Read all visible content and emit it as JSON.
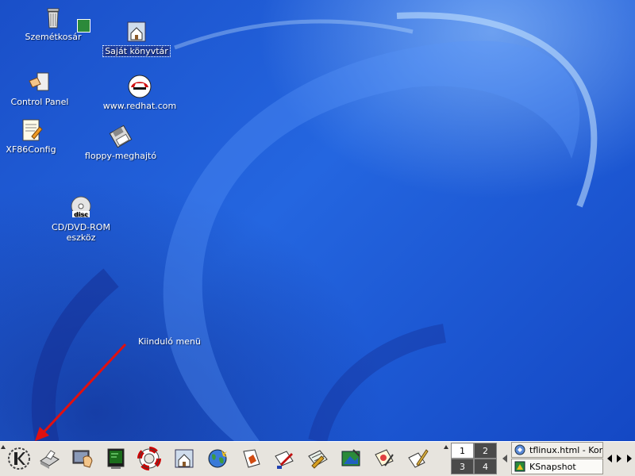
{
  "desktop": {
    "icons": [
      {
        "label": "Szemétkosár",
        "icon": "trash-icon"
      },
      {
        "label": "Saját könyvtár",
        "icon": "home-folder-icon",
        "selected": true
      },
      {
        "label": "Control Panel",
        "icon": "control-panel-icon"
      },
      {
        "label": "www.redhat.com",
        "icon": "redhat-icon"
      },
      {
        "label": "XF86Config",
        "icon": "text-file-icon"
      },
      {
        "label": "floppy-meghajtó",
        "icon": "floppy-icon"
      },
      {
        "label": "CD/DVD-ROM eszköz",
        "icon": "cdrom-icon"
      }
    ],
    "annotation": "Kiinduló menü",
    "colors": {
      "background": "#2466e0",
      "arrow": "#e01010"
    }
  },
  "taskbar": {
    "quick_launch": [
      "kde-k-menu-icon",
      "printer-icon",
      "desktop-hand-icon",
      "terminal-icon",
      "help-lifebuoy-icon",
      "home-icon",
      "web-browser-globe-icon",
      "office-presentation-icon",
      "writer-icon",
      "spreadsheet-icon",
      "image-editor-icon",
      "drawing-icon",
      "text-editor-icon"
    ],
    "pager": [
      "1",
      "2",
      "3",
      "4"
    ],
    "active_desktop": "1",
    "tasks": [
      {
        "label": "tflinux.html - Konqu",
        "icon": "konqueror-icon"
      },
      {
        "label": "KSnapshot",
        "icon": "ksnapshot-icon"
      }
    ]
  }
}
